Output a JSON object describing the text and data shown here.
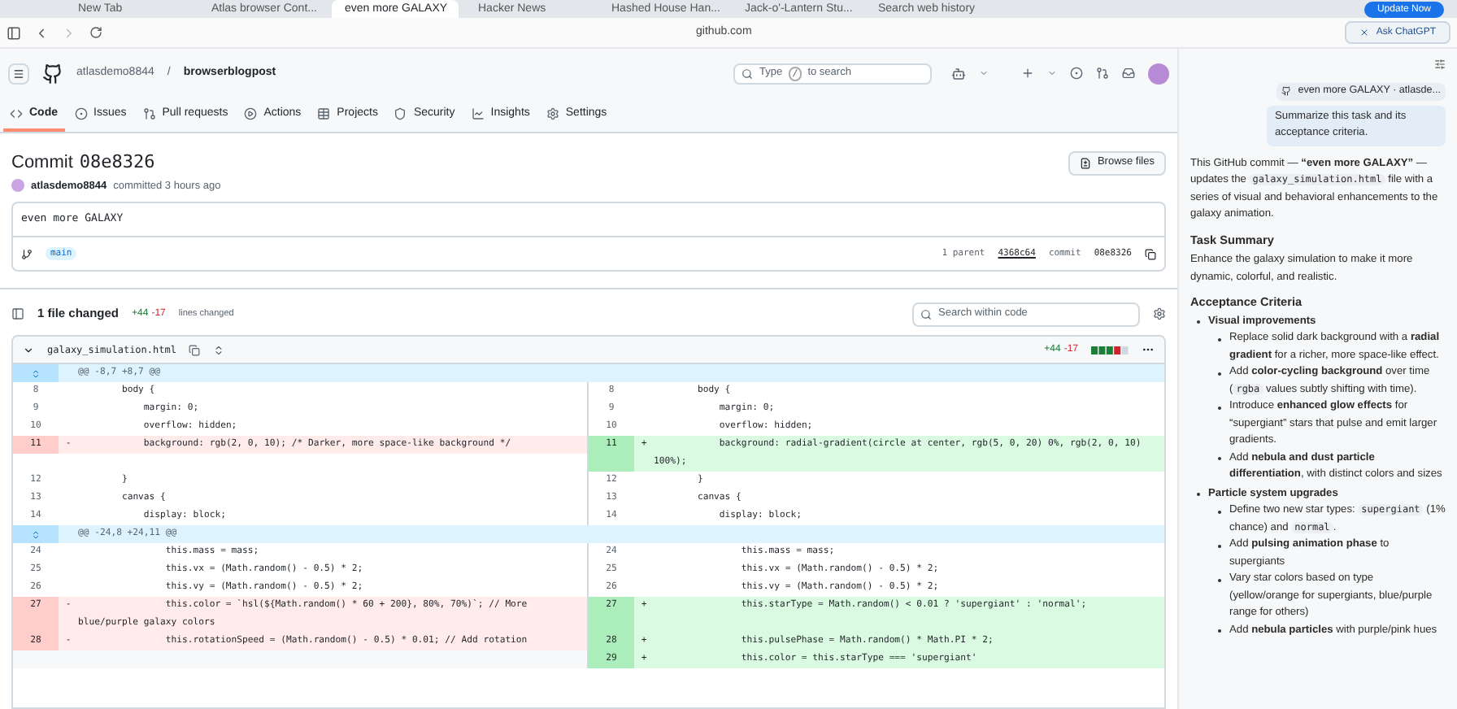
{
  "browser": {
    "tabs": [
      {
        "label": "New Tab",
        "selected": false
      },
      {
        "label": "Atlas browser Cont...",
        "selected": false
      },
      {
        "label": "even more GALAXY",
        "selected": true
      },
      {
        "label": "Hacker News",
        "selected": false
      },
      {
        "label": "Hashed House Han...",
        "selected": false
      },
      {
        "label": "Jack-o'-Lantern Stu...",
        "selected": false
      },
      {
        "label": "Search web history",
        "selected": false
      }
    ],
    "update_button": "Update Now",
    "url": "github.com",
    "ask_button": "Ask ChatGPT"
  },
  "repo": {
    "owner": "atlasdemo8844",
    "separator": "/",
    "name": "browserblogpost",
    "search": {
      "before": "Type",
      "key": "/",
      "after": "to search"
    }
  },
  "nav": [
    {
      "label": "Code",
      "selected": true
    },
    {
      "label": "Issues",
      "selected": false
    },
    {
      "label": "Pull requests",
      "selected": false
    },
    {
      "label": "Actions",
      "selected": false
    },
    {
      "label": "Projects",
      "selected": false
    },
    {
      "label": "Security",
      "selected": false
    },
    {
      "label": "Insights",
      "selected": false
    },
    {
      "label": "Settings",
      "selected": false
    }
  ],
  "commit": {
    "title": "Commit",
    "sha": "08e8326",
    "author": "atlasdemo8844",
    "meta": "committed 3 hours ago",
    "browse_button": "Browse files",
    "message": "even more GALAXY",
    "branch": "main",
    "parent_label": "1 parent",
    "parent_sha": "4368c64",
    "commit_label": "commit",
    "commit_sha": "08e8326"
  },
  "diff": {
    "files_changed": "1 file changed",
    "additions": "+44",
    "deletions": "-17",
    "lines_label": "lines changed",
    "search_placeholder": "Search within code",
    "file": {
      "name": "galaxy_simulation.html",
      "additions": "+44",
      "deletions": "-17"
    },
    "hunks": [
      {
        "header": "@@ -8,7 +8,7 @@",
        "rows": [
          {
            "left": {
              "kind": "context",
              "num": "8",
              "code": "        body {"
            },
            "right": {
              "kind": "context",
              "num": "8",
              "code": "        body {"
            }
          },
          {
            "left": {
              "kind": "context",
              "num": "9",
              "code": "            margin: 0;"
            },
            "right": {
              "kind": "context",
              "num": "9",
              "code": "            margin: 0;"
            }
          },
          {
            "left": {
              "kind": "context",
              "num": "10",
              "code": "            overflow: hidden;"
            },
            "right": {
              "kind": "context",
              "num": "10",
              "code": "            overflow: hidden;"
            }
          },
          {
            "left": {
              "kind": "del",
              "num": "11",
              "sign": "-",
              "code": "            background: rgb(2, 0, 10); /* Darker, more space-like background */"
            },
            "right": {
              "kind": "add",
              "num": "11",
              "sign": "+",
              "code": "            background: radial-gradient(circle at center, rgb(5, 0, 20) 0%, rgb(2, 0, 10) 100%);"
            }
          },
          {
            "left": {
              "kind": "context",
              "num": "12",
              "code": "        }"
            },
            "right": {
              "kind": "context",
              "num": "12",
              "code": "        }"
            }
          },
          {
            "left": {
              "kind": "context",
              "num": "13",
              "code": "        canvas {"
            },
            "right": {
              "kind": "context",
              "num": "13",
              "code": "        canvas {"
            }
          },
          {
            "left": {
              "kind": "context",
              "num": "14",
              "code": "            display: block;"
            },
            "right": {
              "kind": "context",
              "num": "14",
              "code": "            display: block;"
            }
          }
        ]
      },
      {
        "header": "@@ -24,8 +24,11 @@",
        "rows": [
          {
            "left": {
              "kind": "context",
              "num": "24",
              "code": "                this.mass = mass;"
            },
            "right": {
              "kind": "context",
              "num": "24",
              "code": "                this.mass = mass;"
            }
          },
          {
            "left": {
              "kind": "context",
              "num": "25",
              "code": "                this.vx = (Math.random() - 0.5) * 2;"
            },
            "right": {
              "kind": "context",
              "num": "25",
              "code": "                this.vx = (Math.random() - 0.5) * 2;"
            }
          },
          {
            "left": {
              "kind": "context",
              "num": "26",
              "code": "                this.vy = (Math.random() - 0.5) * 2;"
            },
            "right": {
              "kind": "context",
              "num": "26",
              "code": "                this.vy = (Math.random() - 0.5) * 2;"
            }
          },
          {
            "left": {
              "kind": "del",
              "num": "27",
              "sign": "-",
              "code": "                this.color = `hsl(${Math.random() * 60 + 200}, 80%, 70%)`; // More blue/purple galaxy colors"
            },
            "right": {
              "kind": "add",
              "num": "27",
              "sign": "+",
              "code": "                this.starType = Math.random() < 0.01 ? 'supergiant' : 'normal';"
            }
          },
          {
            "left": {
              "kind": "del",
              "num": "28",
              "sign": "-",
              "code": "                this.rotationSpeed = (Math.random() - 0.5) * 0.01; // Add rotation"
            },
            "right": {
              "kind": "add",
              "num": "28",
              "sign": "+",
              "code": "                this.pulsePhase = Math.random() * Math.PI * 2;"
            }
          },
          {
            "left": {
              "kind": "empty"
            },
            "right": {
              "kind": "add",
              "num": "29",
              "sign": "+",
              "code": "                this.color = this.starType === 'supergiant'"
            }
          }
        ]
      }
    ]
  },
  "assistant": {
    "thread_title": "even more GALAXY · atlasde...",
    "prompt": "Summarize this task and its acceptance criteria.",
    "intro": [
      {
        "kind": "text",
        "text": "This GitHub commit — **“even more GALAXY”** — updates the "
      },
      {
        "kind": "code",
        "text": "galaxy_simulation.html"
      },
      {
        "kind": "text",
        "text": " file with a series of visual and behavioral enhancements to the galaxy animation."
      }
    ],
    "sections": [
      {
        "heading": "Task Summary",
        "paragraph": "Enhance the galaxy simulation to make it more dynamic, colorful, and realistic."
      },
      {
        "heading": "Acceptance Criteria",
        "items": [
          {
            "label": "Visual improvements",
            "children": [
              [
                {
                  "kind": "text",
                  "text": "Replace solid dark background with a **radial gradient** for a richer, more space-like effect."
                }
              ],
              [
                {
                  "kind": "text",
                  "text": "Add **color-cycling background** over time ("
                },
                {
                  "kind": "code",
                  "text": "rgba"
                },
                {
                  "kind": "text",
                  "text": " values subtly shifting with time)."
                }
              ],
              [
                {
                  "kind": "text",
                  "text": "Introduce **enhanced glow effects** for “supergiant” stars that pulse and emit larger gradients."
                }
              ],
              [
                {
                  "kind": "text",
                  "text": "Add **nebula and dust particle differentiation**, with distinct colors and sizes"
                }
              ]
            ]
          },
          {
            "label": "Particle system upgrades",
            "children": [
              [
                {
                  "kind": "text",
                  "text": "Define two new star types: "
                },
                {
                  "kind": "code",
                  "text": "supergiant"
                },
                {
                  "kind": "text",
                  "text": " (1% chance) and "
                },
                {
                  "kind": "code",
                  "text": "normal"
                },
                {
                  "kind": "text",
                  "text": "."
                }
              ],
              [
                {
                  "kind": "text",
                  "text": "Add **pulsing animation phase** to supergiants"
                }
              ],
              [
                {
                  "kind": "text",
                  "text": "Vary star colors based on type (yellow/orange for supergiants, blue/purple range for others)"
                }
              ],
              [
                {
                  "kind": "text",
                  "text": "Add **nebula particles** with purple/pink hues"
                }
              ]
            ]
          }
        ]
      }
    ]
  }
}
